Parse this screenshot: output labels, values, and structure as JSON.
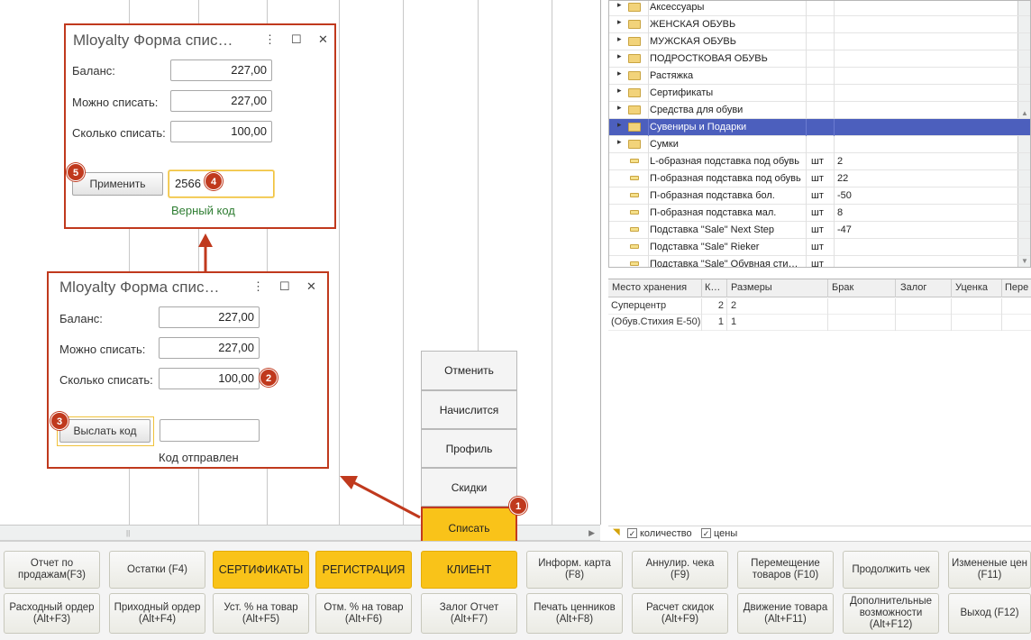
{
  "tree": {
    "rows": [
      {
        "type": "folder",
        "name": "Аксессуары",
        "unit": "",
        "qty": "",
        "selected": false
      },
      {
        "type": "folder",
        "name": "ЖЕНСКАЯ ОБУВЬ",
        "unit": "",
        "qty": "",
        "selected": false
      },
      {
        "type": "folder",
        "name": "МУЖСКАЯ ОБУВЬ",
        "unit": "",
        "qty": "",
        "selected": false
      },
      {
        "type": "folder",
        "name": "ПОДРОСТКОВАЯ ОБУВЬ",
        "unit": "",
        "qty": "",
        "selected": false
      },
      {
        "type": "folder",
        "name": "Растяжка",
        "unit": "",
        "qty": "",
        "selected": false
      },
      {
        "type": "folder",
        "name": "Сертификаты",
        "unit": "",
        "qty": "",
        "selected": false
      },
      {
        "type": "folder",
        "name": "Средства для обуви",
        "unit": "",
        "qty": "",
        "selected": false
      },
      {
        "type": "folder",
        "name": "Сувениры и Подарки",
        "unit": "",
        "qty": "",
        "selected": true
      },
      {
        "type": "folder",
        "name": "Сумки",
        "unit": "",
        "qty": "",
        "selected": false
      },
      {
        "type": "item",
        "name": "L-образная подставка под обувь",
        "unit": "шт",
        "qty": "2",
        "selected": false
      },
      {
        "type": "item",
        "name": "П-образная подставка под обувь",
        "unit": "шт",
        "qty": "22",
        "selected": false
      },
      {
        "type": "item",
        "name": "П-образная подставка бол.",
        "unit": "шт",
        "qty": "-50",
        "selected": false
      },
      {
        "type": "item",
        "name": "П-образная подставка мал.",
        "unit": "шт",
        "qty": "8",
        "selected": false
      },
      {
        "type": "item",
        "name": "Подставка \"Sale\" Next Step",
        "unit": "шт",
        "qty": "-47",
        "selected": false
      },
      {
        "type": "item",
        "name": "Подставка \"Sale\" Rieker",
        "unit": "шт",
        "qty": "",
        "selected": false
      },
      {
        "type": "item",
        "name": "Подставка \"Sale\" Обувная сти…",
        "unit": "шт",
        "qty": "",
        "selected": false
      }
    ]
  },
  "storage": {
    "headers": [
      "Место хранения",
      "К…",
      "Размеры",
      "Брак",
      "Залог",
      "Уценка",
      "Пере"
    ],
    "rows": [
      [
        "Суперцентр",
        "2",
        "2"
      ],
      [
        "(Обув.Стихия Е-50)",
        "1",
        "1"
      ]
    ]
  },
  "checkboxes": {
    "quantity_label": "количество",
    "prices_label": "цены",
    "check_mark": "✓"
  },
  "side_menu": {
    "items": [
      {
        "label": "Отменить",
        "active": false
      },
      {
        "label": "Начислится",
        "active": false
      },
      {
        "label": "Профиль",
        "active": false
      },
      {
        "label": "Скидки",
        "active": false
      },
      {
        "label": "Списать",
        "active": true
      }
    ]
  },
  "dialog_top": {
    "title": "Mloyalty Форма спис…",
    "balance_label": "Баланс:",
    "balance_value": "227,00",
    "can_write_off_label": "Можно списать:",
    "can_write_off_value": "227,00",
    "write_off_label": "Сколько списать:",
    "write_off_value": "100,00",
    "apply_button": "Применить",
    "code_value": "2566",
    "status": "Верный код",
    "status_color": "#2e7d32"
  },
  "dialog_bottom": {
    "title": "Mloyalty Форма спис…",
    "balance_label": "Баланс:",
    "balance_value": "227,00",
    "can_write_off_label": "Можно списать:",
    "can_write_off_value": "227,00",
    "write_off_label": "Сколько списать:",
    "write_off_value": "100,00",
    "send_code_button": "Выслать код",
    "code_value": "",
    "status": "Код отправлен",
    "status_color": "#333333"
  },
  "window_controls": {
    "menu": "⋮",
    "maximize": "☐",
    "close": "✕"
  },
  "badges": {
    "b1": "1",
    "b2": "2",
    "b3": "3",
    "b4": "4",
    "b5": "5"
  },
  "bottom_row1": [
    {
      "label": "Отчет по продажам(F3)",
      "yellow": false
    },
    {
      "label": "Остатки (F4)",
      "yellow": false
    },
    {
      "label": "СЕРТИФИКАТЫ",
      "yellow": true
    },
    {
      "label": "РЕГИСТРАЦИЯ",
      "yellow": true
    },
    {
      "label": "КЛИЕНТ",
      "yellow": true
    },
    {
      "label": "Информ. карта (F8)",
      "yellow": false
    },
    {
      "label": "Аннулир. чека (F9)",
      "yellow": false
    },
    {
      "label": "Перемещение товаров (F10)",
      "yellow": false
    },
    {
      "label": "Продолжить чек",
      "yellow": false
    },
    {
      "label": "Измененые цен (F11)",
      "yellow": false
    }
  ],
  "bottom_row2": [
    {
      "label": "Расходный ордер (Alt+F3)",
      "yellow": false
    },
    {
      "label": "Приходный ордер (Alt+F4)",
      "yellow": false
    },
    {
      "label": "Уст. % на товар (Alt+F5)",
      "yellow": false
    },
    {
      "label": "Отм. % на товар (Alt+F6)",
      "yellow": false
    },
    {
      "label": "Залог Отчет (Alt+F7)",
      "yellow": false
    },
    {
      "label": "Печать ценников (Alt+F8)",
      "yellow": false
    },
    {
      "label": "Расчет скидок (Alt+F9)",
      "yellow": false
    },
    {
      "label": "Движение товара (Alt+F11)",
      "yellow": false
    },
    {
      "label": "Дополнительные возможности (Alt+F12)",
      "yellow": false
    },
    {
      "label": "Выход (F12)",
      "yellow": false
    }
  ],
  "colors": {
    "accent_red": "#c0391d",
    "highlight_yellow": "#f9c319",
    "selection_blue": "#4c5fbd"
  }
}
